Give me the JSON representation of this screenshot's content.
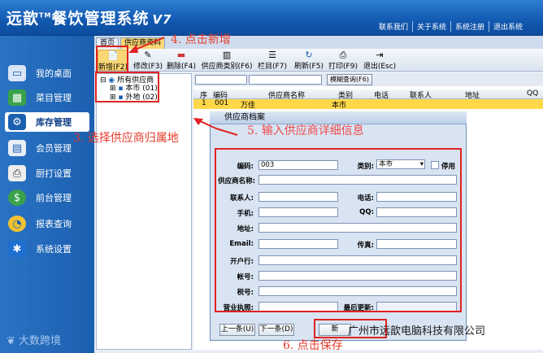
{
  "app": {
    "name": "远歆",
    "tm": "TM",
    "subtitle": "餐饮管理系统",
    "version": "V7"
  },
  "top_links": [
    "联系我们",
    "关于系统",
    "系统注册",
    "退出系统"
  ],
  "sidebar": {
    "items": [
      {
        "label": "我的桌面",
        "icon": "monitor-icon"
      },
      {
        "label": "菜目管理",
        "icon": "menu-grid-icon"
      },
      {
        "label": "库存管理",
        "icon": "gear-icon"
      },
      {
        "label": "会员管理",
        "icon": "member-card-icon"
      },
      {
        "label": "厨打设置",
        "icon": "printer-icon"
      },
      {
        "label": "前台管理",
        "icon": "dollar-icon"
      },
      {
        "label": "报表查询",
        "icon": "chart-icon"
      },
      {
        "label": "系统设置",
        "icon": "settings-icon"
      }
    ],
    "footer": "大数跨境"
  },
  "tabs": [
    "首页",
    "供应商资料"
  ],
  "toolbar": {
    "items": [
      "新增(F2)",
      "修改(F3)",
      "删除(F4)",
      "供应商类别(F6)",
      "栏目(F7)",
      "刷新(F5)",
      "打印(F9)",
      "退出(Esc)"
    ]
  },
  "tree": {
    "root": "所有供应商",
    "children": [
      "本市 (01)",
      "外地 (02)"
    ]
  },
  "filter": {
    "query_button": "模糊查询(F6)"
  },
  "grid": {
    "columns": [
      "序",
      "编码",
      "供应商名称",
      "类别",
      "电话",
      "联系人",
      "地址",
      "QQ"
    ],
    "rows": [
      {
        "seq": "1",
        "code": "001",
        "name": "万佳",
        "type": "本市"
      }
    ]
  },
  "dialog": {
    "title": "供应商档案",
    "fields": {
      "code_label": "编码:",
      "code_value": "003",
      "type_label": "类别:",
      "type_value": "本市",
      "disable_label": "停用",
      "name_label": "供应商名称:",
      "contact_label": "联系人:",
      "phone_label": "电话:",
      "mobile_label": "手机:",
      "qq_label": "QQ:",
      "address_label": "地址:",
      "email_label": "Email:",
      "fax_label": "传真:",
      "bank_label": "开户行:",
      "account_label": "帐号:",
      "tax_label": "税号:",
      "license_label": "营业执照:",
      "updated_label": "最后更新:"
    },
    "buttons": {
      "prev": "上一条(U)",
      "next": "下一条(D)",
      "add": "新"
    }
  },
  "annotations": {
    "step4": "4. 点击新增",
    "step3": "3. 选择供应商归属地",
    "step5": "5. 输入供应商详细信息",
    "step6": "6. 点击保存"
  },
  "watermark": "广州市远歆电脑科技有限公司",
  "colors": {
    "accent": "#1b5fb0",
    "highlight_row": "#ffd84a",
    "annotation": "#e02222"
  }
}
